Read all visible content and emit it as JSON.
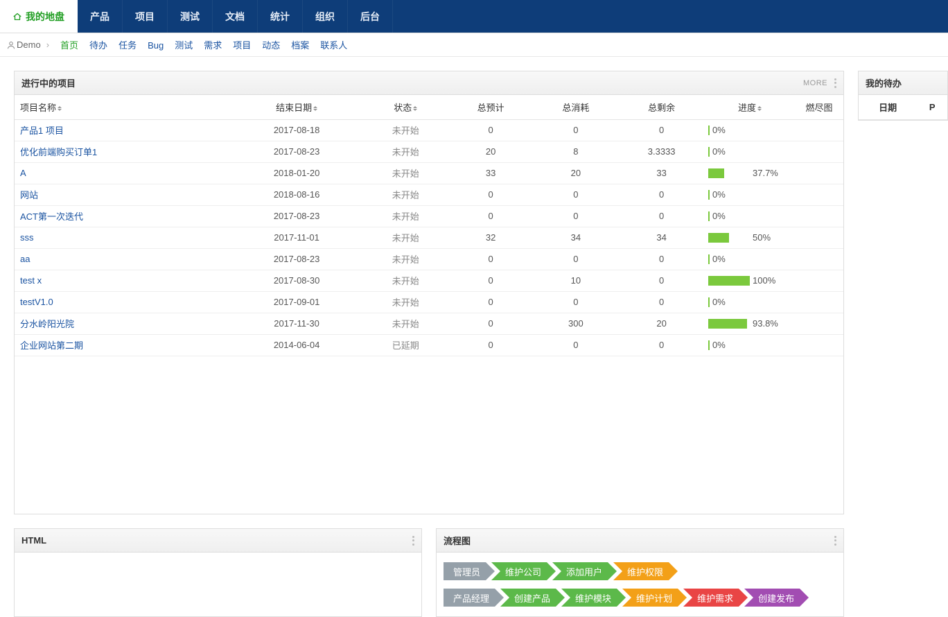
{
  "topnav": {
    "items": [
      {
        "label": "我的地盘",
        "active": true,
        "icon": true
      },
      {
        "label": "产品"
      },
      {
        "label": "项目"
      },
      {
        "label": "测试"
      },
      {
        "label": "文档"
      },
      {
        "label": "统计"
      },
      {
        "label": "组织"
      },
      {
        "label": "后台"
      }
    ]
  },
  "submenu": {
    "user": "Demo",
    "items": [
      {
        "label": "首页",
        "active": true
      },
      {
        "label": "待办"
      },
      {
        "label": "任务"
      },
      {
        "label": "Bug"
      },
      {
        "label": "测试"
      },
      {
        "label": "需求"
      },
      {
        "label": "项目"
      },
      {
        "label": "动态"
      },
      {
        "label": "档案"
      },
      {
        "label": "联系人"
      }
    ]
  },
  "projects_panel": {
    "title": "进行中的项目",
    "more": "MORE",
    "columns": {
      "name": "项目名称",
      "end": "结束日期",
      "status": "状态",
      "est": "总预计",
      "cost": "总消耗",
      "left": "总剩余",
      "progress": "进度",
      "burndown": "燃尽图"
    },
    "rows": [
      {
        "name": "产品1 项目",
        "end": "2017-08-18",
        "status": "未开始",
        "est": "0",
        "cost": "0",
        "left": "0",
        "pct": 0,
        "pct_label": "0%"
      },
      {
        "name": "优化前端购买订单1",
        "end": "2017-08-23",
        "status": "未开始",
        "est": "20",
        "cost": "8",
        "left": "3.3333",
        "pct": 0,
        "pct_label": "0%"
      },
      {
        "name": "A",
        "end": "2018-01-20",
        "status": "未开始",
        "est": "33",
        "cost": "20",
        "left": "33",
        "pct": 37.7,
        "pct_label": "37.7%"
      },
      {
        "name": "网站",
        "end": "2018-08-16",
        "status": "未开始",
        "est": "0",
        "cost": "0",
        "left": "0",
        "pct": 0,
        "pct_label": "0%"
      },
      {
        "name": "ACT第一次迭代",
        "end": "2017-08-23",
        "status": "未开始",
        "est": "0",
        "cost": "0",
        "left": "0",
        "pct": 0,
        "pct_label": "0%"
      },
      {
        "name": "sss",
        "end": "2017-11-01",
        "status": "未开始",
        "est": "32",
        "cost": "34",
        "left": "34",
        "pct": 50,
        "pct_label": "50%"
      },
      {
        "name": "aa",
        "end": "2017-08-23",
        "status": "未开始",
        "est": "0",
        "cost": "0",
        "left": "0",
        "pct": 0,
        "pct_label": "0%"
      },
      {
        "name": "test x",
        "end": "2017-08-30",
        "status": "未开始",
        "est": "0",
        "cost": "10",
        "left": "0",
        "pct": 100,
        "pct_label": "100%"
      },
      {
        "name": "testV1.0",
        "end": "2017-09-01",
        "status": "未开始",
        "est": "0",
        "cost": "0",
        "left": "0",
        "pct": 0,
        "pct_label": "0%"
      },
      {
        "name": "分水岭阳光院",
        "end": "2017-11-30",
        "status": "未开始",
        "est": "0",
        "cost": "300",
        "left": "20",
        "pct": 93.8,
        "pct_label": "93.8%"
      },
      {
        "name": "企业网站第二期",
        "end": "2014-06-04",
        "status": "已延期",
        "est": "0",
        "cost": "0",
        "left": "0",
        "pct": 0,
        "pct_label": "0%"
      }
    ]
  },
  "html_panel": {
    "title": "HTML"
  },
  "flow_panel": {
    "title": "流程图",
    "rows": [
      [
        {
          "label": "管理员",
          "cls": "c-gray"
        },
        {
          "label": "维护公司",
          "cls": "c-green"
        },
        {
          "label": "添加用户",
          "cls": "c-green"
        },
        {
          "label": "维护权限",
          "cls": "c-orange"
        }
      ],
      [
        {
          "label": "产品经理",
          "cls": "c-gray"
        },
        {
          "label": "创建产品",
          "cls": "c-green"
        },
        {
          "label": "维护模块",
          "cls": "c-green"
        },
        {
          "label": "维护计划",
          "cls": "c-orange"
        },
        {
          "label": "维护需求",
          "cls": "c-red"
        },
        {
          "label": "创建发布",
          "cls": "c-purple"
        }
      ]
    ]
  },
  "todo_panel": {
    "title": "我的待办",
    "columns": {
      "date": "日期",
      "p": "P"
    }
  }
}
